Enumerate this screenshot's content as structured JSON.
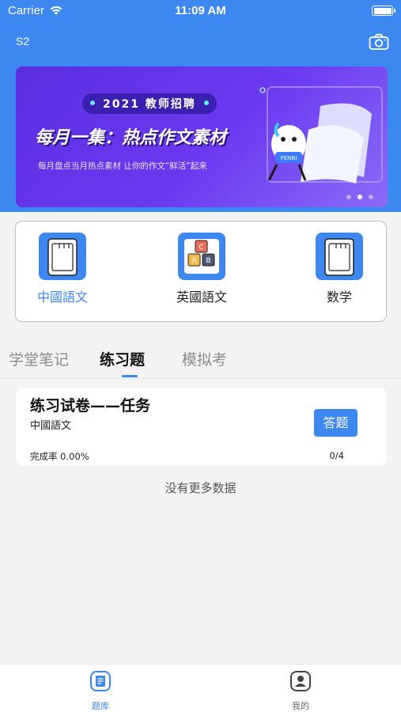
{
  "status_bar": {
    "carrier": "Carrier",
    "time": "11:09 AM"
  },
  "header": {
    "title": "S2",
    "camera_icon": "camera-icon"
  },
  "banner": {
    "pill": "2021 教师招聘",
    "headline": "每月一集：热点作文素材",
    "subtitle": "每月盘点当月热点素材  让你的作文“鲜活”起来",
    "mascot_text": "FENBI",
    "page_count": 3,
    "active_page": 2
  },
  "subjects": [
    {
      "label": "中國語文",
      "icon": "notebook-icon",
      "active": true
    },
    {
      "label": "英國語文",
      "icon": "abc-blocks-icon",
      "active": false
    },
    {
      "label": "数学",
      "icon": "notebook-icon",
      "active": false
    }
  ],
  "tabs": [
    {
      "label": "学堂笔记",
      "active": false
    },
    {
      "label": "练习题",
      "active": true
    },
    {
      "label": "模拟考",
      "active": false
    }
  ],
  "task": {
    "title": "练习试卷——任务",
    "subject": "中國語文",
    "button": "答题",
    "completion": "完成率 0.00%",
    "progress": "0/4"
  },
  "empty_hint": "没有更多数据",
  "tabbar": [
    {
      "label": "题库",
      "icon": "question-bank-icon",
      "active": true
    },
    {
      "label": "我的",
      "icon": "profile-icon",
      "active": false
    }
  ],
  "colors": {
    "primary": "#3d87f0",
    "background": "#f3f3f3"
  }
}
